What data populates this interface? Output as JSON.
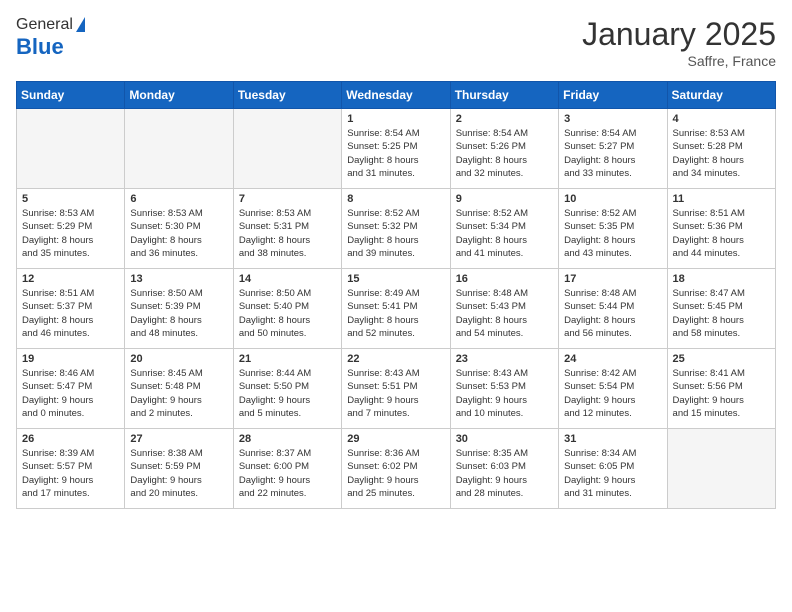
{
  "header": {
    "logo_general": "General",
    "logo_blue": "Blue",
    "month_title": "January 2025",
    "location": "Saffre, France"
  },
  "weekdays": [
    "Sunday",
    "Monday",
    "Tuesday",
    "Wednesday",
    "Thursday",
    "Friday",
    "Saturday"
  ],
  "weeks": [
    [
      {
        "day": "",
        "info": ""
      },
      {
        "day": "",
        "info": ""
      },
      {
        "day": "",
        "info": ""
      },
      {
        "day": "1",
        "info": "Sunrise: 8:54 AM\nSunset: 5:25 PM\nDaylight: 8 hours\nand 31 minutes."
      },
      {
        "day": "2",
        "info": "Sunrise: 8:54 AM\nSunset: 5:26 PM\nDaylight: 8 hours\nand 32 minutes."
      },
      {
        "day": "3",
        "info": "Sunrise: 8:54 AM\nSunset: 5:27 PM\nDaylight: 8 hours\nand 33 minutes."
      },
      {
        "day": "4",
        "info": "Sunrise: 8:53 AM\nSunset: 5:28 PM\nDaylight: 8 hours\nand 34 minutes."
      }
    ],
    [
      {
        "day": "5",
        "info": "Sunrise: 8:53 AM\nSunset: 5:29 PM\nDaylight: 8 hours\nand 35 minutes."
      },
      {
        "day": "6",
        "info": "Sunrise: 8:53 AM\nSunset: 5:30 PM\nDaylight: 8 hours\nand 36 minutes."
      },
      {
        "day": "7",
        "info": "Sunrise: 8:53 AM\nSunset: 5:31 PM\nDaylight: 8 hours\nand 38 minutes."
      },
      {
        "day": "8",
        "info": "Sunrise: 8:52 AM\nSunset: 5:32 PM\nDaylight: 8 hours\nand 39 minutes."
      },
      {
        "day": "9",
        "info": "Sunrise: 8:52 AM\nSunset: 5:34 PM\nDaylight: 8 hours\nand 41 minutes."
      },
      {
        "day": "10",
        "info": "Sunrise: 8:52 AM\nSunset: 5:35 PM\nDaylight: 8 hours\nand 43 minutes."
      },
      {
        "day": "11",
        "info": "Sunrise: 8:51 AM\nSunset: 5:36 PM\nDaylight: 8 hours\nand 44 minutes."
      }
    ],
    [
      {
        "day": "12",
        "info": "Sunrise: 8:51 AM\nSunset: 5:37 PM\nDaylight: 8 hours\nand 46 minutes."
      },
      {
        "day": "13",
        "info": "Sunrise: 8:50 AM\nSunset: 5:39 PM\nDaylight: 8 hours\nand 48 minutes."
      },
      {
        "day": "14",
        "info": "Sunrise: 8:50 AM\nSunset: 5:40 PM\nDaylight: 8 hours\nand 50 minutes."
      },
      {
        "day": "15",
        "info": "Sunrise: 8:49 AM\nSunset: 5:41 PM\nDaylight: 8 hours\nand 52 minutes."
      },
      {
        "day": "16",
        "info": "Sunrise: 8:48 AM\nSunset: 5:43 PM\nDaylight: 8 hours\nand 54 minutes."
      },
      {
        "day": "17",
        "info": "Sunrise: 8:48 AM\nSunset: 5:44 PM\nDaylight: 8 hours\nand 56 minutes."
      },
      {
        "day": "18",
        "info": "Sunrise: 8:47 AM\nSunset: 5:45 PM\nDaylight: 8 hours\nand 58 minutes."
      }
    ],
    [
      {
        "day": "19",
        "info": "Sunrise: 8:46 AM\nSunset: 5:47 PM\nDaylight: 9 hours\nand 0 minutes."
      },
      {
        "day": "20",
        "info": "Sunrise: 8:45 AM\nSunset: 5:48 PM\nDaylight: 9 hours\nand 2 minutes."
      },
      {
        "day": "21",
        "info": "Sunrise: 8:44 AM\nSunset: 5:50 PM\nDaylight: 9 hours\nand 5 minutes."
      },
      {
        "day": "22",
        "info": "Sunrise: 8:43 AM\nSunset: 5:51 PM\nDaylight: 9 hours\nand 7 minutes."
      },
      {
        "day": "23",
        "info": "Sunrise: 8:43 AM\nSunset: 5:53 PM\nDaylight: 9 hours\nand 10 minutes."
      },
      {
        "day": "24",
        "info": "Sunrise: 8:42 AM\nSunset: 5:54 PM\nDaylight: 9 hours\nand 12 minutes."
      },
      {
        "day": "25",
        "info": "Sunrise: 8:41 AM\nSunset: 5:56 PM\nDaylight: 9 hours\nand 15 minutes."
      }
    ],
    [
      {
        "day": "26",
        "info": "Sunrise: 8:39 AM\nSunset: 5:57 PM\nDaylight: 9 hours\nand 17 minutes."
      },
      {
        "day": "27",
        "info": "Sunrise: 8:38 AM\nSunset: 5:59 PM\nDaylight: 9 hours\nand 20 minutes."
      },
      {
        "day": "28",
        "info": "Sunrise: 8:37 AM\nSunset: 6:00 PM\nDaylight: 9 hours\nand 22 minutes."
      },
      {
        "day": "29",
        "info": "Sunrise: 8:36 AM\nSunset: 6:02 PM\nDaylight: 9 hours\nand 25 minutes."
      },
      {
        "day": "30",
        "info": "Sunrise: 8:35 AM\nSunset: 6:03 PM\nDaylight: 9 hours\nand 28 minutes."
      },
      {
        "day": "31",
        "info": "Sunrise: 8:34 AM\nSunset: 6:05 PM\nDaylight: 9 hours\nand 31 minutes."
      },
      {
        "day": "",
        "info": ""
      }
    ]
  ]
}
